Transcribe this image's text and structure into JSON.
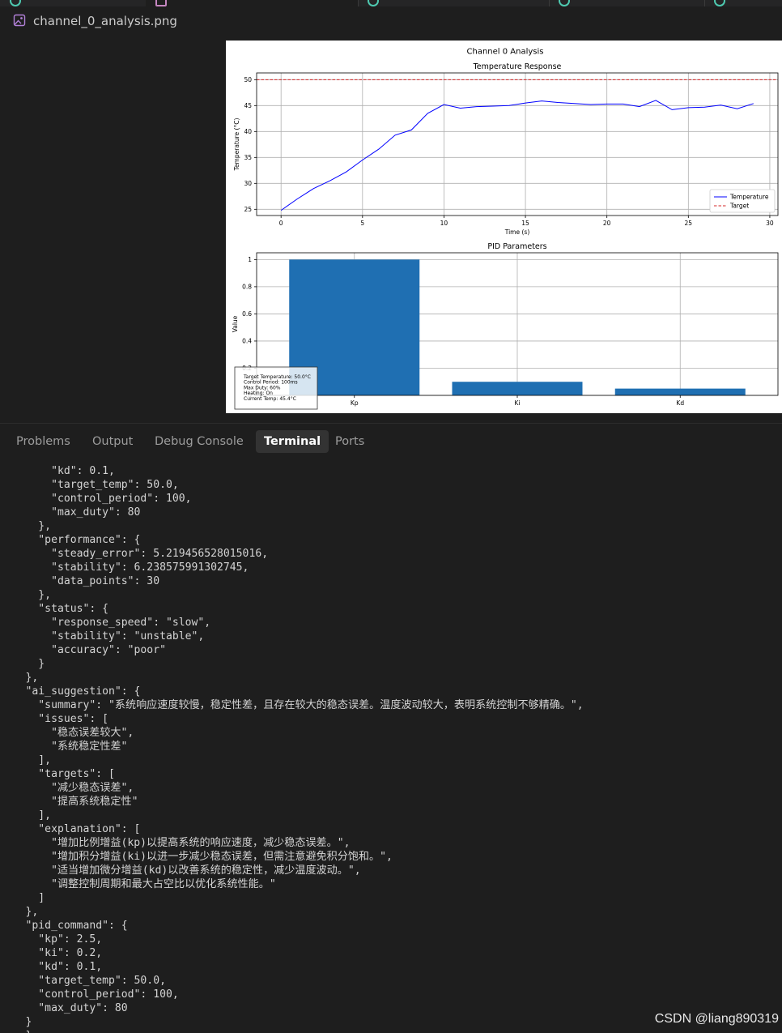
{
  "editor": {
    "tabs": [
      {
        "active": false,
        "icon": "python-file-icon"
      },
      {
        "active": true,
        "icon": "image-file-icon"
      },
      {
        "active": false,
        "icon": "python-file-icon"
      },
      {
        "active": false,
        "icon": "python-file-icon"
      },
      {
        "active": false,
        "icon": "python-file-icon"
      }
    ],
    "file_title": "channel_0_analysis.png",
    "file_icon": "image-file-icon"
  },
  "figure": {
    "suptitle": "Channel 0 Analysis",
    "info_box": [
      "Target Temperature: 50.0°C",
      "Control Period: 100ms",
      "Max Duty: 60%",
      "Heating: On",
      "Current Temp: 45.4°C"
    ]
  },
  "chart_data": [
    {
      "type": "line",
      "title": "Temperature Response",
      "xlabel": "Time (s)",
      "ylabel": "Temperature (°C)",
      "xlim": [
        -1.5,
        30.5
      ],
      "ylim": [
        23.8,
        51.3
      ],
      "xticks": [
        0,
        5,
        10,
        15,
        20,
        25,
        30
      ],
      "yticks": [
        25,
        30,
        35,
        40,
        45,
        50
      ],
      "grid": true,
      "legend": "bottom-right",
      "x": [
        0,
        1,
        2,
        3,
        4,
        5,
        6,
        7,
        8,
        9,
        10,
        11,
        12,
        13,
        14,
        15,
        16,
        17,
        18,
        19,
        20,
        21,
        22,
        23,
        24,
        25,
        26,
        27,
        28,
        29
      ],
      "series": [
        {
          "name": "Temperature",
          "color": "#0000ff",
          "style": "solid",
          "values": [
            24.8,
            27.0,
            29.0,
            30.5,
            32.2,
            34.5,
            36.6,
            39.3,
            40.3,
            43.5,
            45.2,
            44.5,
            44.8,
            44.9,
            45.0,
            45.5,
            45.9,
            45.6,
            45.4,
            45.2,
            45.3,
            45.3,
            44.8,
            46.0,
            44.2,
            44.6,
            44.7,
            45.1,
            44.4,
            45.4
          ]
        },
        {
          "name": "Target",
          "color": "#d62728",
          "style": "dashed",
          "values": [
            50.0
          ]
        }
      ]
    },
    {
      "type": "bar",
      "title": "PID Parameters",
      "ylabel": "Value",
      "categories": [
        "Kp",
        "Ki",
        "Kd"
      ],
      "values": [
        1.0,
        0.1,
        0.05
      ],
      "ylim": [
        0,
        1.05
      ],
      "yticks": [
        0.0,
        0.2,
        0.4,
        0.6,
        0.8,
        1.0
      ],
      "grid": true,
      "color": "#1f6fb2"
    }
  ],
  "panel": {
    "tabs": [
      {
        "label": "Problems",
        "active": false
      },
      {
        "label": "Output",
        "active": false
      },
      {
        "label": "Debug Console",
        "active": false
      },
      {
        "label": "Terminal",
        "active": true
      },
      {
        "label": "Ports",
        "active": false
      }
    ]
  },
  "terminal": {
    "lines": [
      "    \"kd\": 0.1,",
      "    \"target_temp\": 50.0,",
      "    \"control_period\": 100,",
      "    \"max_duty\": 80",
      "  },",
      "  \"performance\": {",
      "    \"steady_error\": 5.219456528015016,",
      "    \"stability\": 6.238575991302745,",
      "    \"data_points\": 30",
      "  },",
      "  \"status\": {",
      "    \"response_speed\": \"slow\",",
      "    \"stability\": \"unstable\",",
      "    \"accuracy\": \"poor\"",
      "  }",
      "},",
      "\"ai_suggestion\": {",
      "  \"summary\": \"系统响应速度较慢，稳定性差，且存在较大的稳态误差。温度波动较大，表明系统控制不够精确。\",",
      "  \"issues\": [",
      "    \"稳态误差较大\",",
      "    \"系统稳定性差\"",
      "  ],",
      "  \"targets\": [",
      "    \"减少稳态误差\",",
      "    \"提高系统稳定性\"",
      "  ],",
      "  \"explanation\": [",
      "    \"增加比例增益(kp)以提高系统的响应速度，减少稳态误差。\",",
      "    \"增加积分增益(ki)以进一步减少稳态误差，但需注意避免积分饱和。\",",
      "    \"适当增加微分增益(kd)以改善系统的稳定性，减少温度波动。\",",
      "    \"调整控制周期和最大占空比以优化系统性能。\"",
      "  ]",
      "},",
      "\"pid_command\": {",
      "  \"kp\": 2.5,",
      "  \"ki\": 0.2,",
      "  \"kd\": 0.1,",
      "  \"target_temp\": 50.0,",
      "  \"control_period\": 100,",
      "  \"max_duty\": 80",
      "}",
      "}"
    ],
    "indent_base": "    "
  },
  "watermark": "CSDN @liang890319"
}
